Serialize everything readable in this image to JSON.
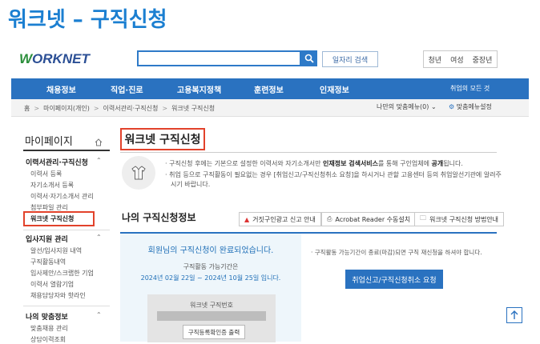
{
  "page_heading": "워크넷 – 구직신청",
  "header": {
    "logo_w": "W",
    "logo_rest": "ORKNET",
    "search": {
      "value": "",
      "placeholder": ""
    },
    "job_search_button": "일자리 검색",
    "top_links": [
      "청년",
      "여성",
      "중장년"
    ]
  },
  "gnb": {
    "items": [
      "채용정보",
      "직업·진로",
      "고용복지정책",
      "훈련정보",
      "인재정보"
    ],
    "all_services": "취업의 모든 것"
  },
  "breadcrumb": {
    "items": [
      "홈",
      "마이페이지(개인)",
      "이력서관리·구직신청",
      "워크넷 구직신청"
    ],
    "my_menu": "나만의 맞춤메뉴(0)",
    "menu_settings": "맞춤메뉴설정"
  },
  "sidebar": {
    "title": "마이페이지",
    "groups": [
      {
        "label": "이력서관리·구직신청",
        "items": [
          "이력서 등록",
          "자기소개서 등록",
          "이력서·자기소개서 관리",
          "첨부파일 관리",
          "워크넷 구직신청"
        ]
      },
      {
        "label": "입사지원 관리",
        "items": [
          "알선/입사지원 내역",
          "구직활동내역",
          "입사제안/스크랩한 기업",
          "이력서 열람기업",
          "채용담당자와 핫라인"
        ]
      },
      {
        "label": "나의 맞춤정보",
        "items": [
          "맞춤채용 관리",
          "상담이력조회"
        ]
      }
    ],
    "active_item": "워크넷 구직신청"
  },
  "main": {
    "title": "워크넷 구직신청",
    "notice_1_pre": "· 구직신청 후에는 기본으로 설정한 이력서와 자기소개서만 ",
    "notice_1_bold1": "인재정보 검색서비스",
    "notice_1_mid": "를 통해 구인업체에 ",
    "notice_1_bold2": "공개",
    "notice_1_post": "됩니다.",
    "notice_2_line1": "· 취업 등으로 구직활동이 필요없는 경우 [취업신고/구직신청취소 요청]을 하시거나 관할 고용센터 등의 취업알선기관에 알려주",
    "notice_2_line2": "시기 바랍니다.",
    "section_title": "나의 구직신청정보",
    "section_buttons": [
      "거짓구인광고 신고 안내",
      "Acrobat Reader 수동설치",
      "워크넷 구직신청 방법안내"
    ],
    "done_message": "회원님의 구직신청이 완료되었습니다.",
    "period_label": "구직활동 가능기간은",
    "period_value": "2024년 02월 22일 ~ 2024년 10월 25일 입니다.",
    "number_label": "워크넷 구직번호",
    "print_button": "구직등록확인증 출력",
    "right_notice": "· 구직활동 가능기간이 종료(마감)되면 구직 재신청을 하셔야 합니다.",
    "cancel_button": "취업신고/구직신청취소 요청"
  },
  "colors": {
    "heading": "#1b7fd1",
    "nav_blue": "#2a72c0",
    "highlight_red": "#e2422b",
    "logo_green": "#2c8f3c",
    "logo_navy": "#2b4f95"
  },
  "icons": [
    "search-icon",
    "home-icon",
    "shirt-icon",
    "chevron-up-icon",
    "warning-icon",
    "printer-icon",
    "folder-icon",
    "gear-icon",
    "arrow-up-icon"
  ]
}
